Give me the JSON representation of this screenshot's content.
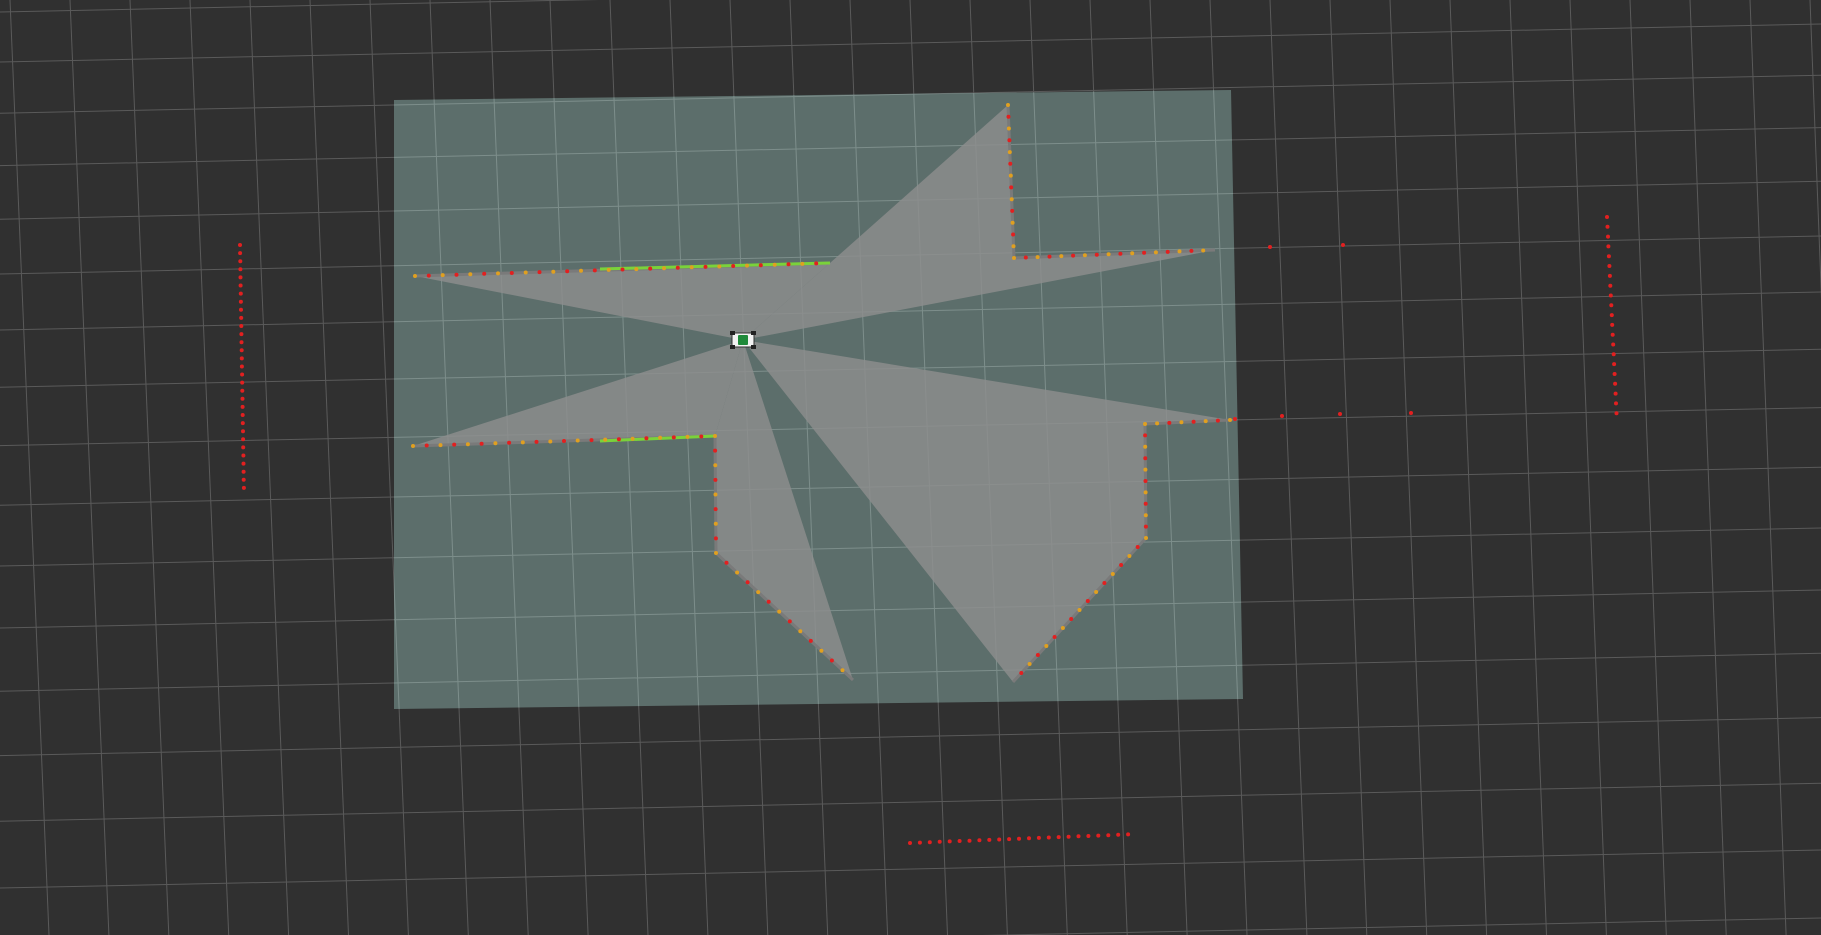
{
  "view": {
    "background_color": "#303030",
    "grid_color": "#5a5a5a",
    "map_color": "#5f726f",
    "scan_color": "#8e8e8e",
    "scan_point_color": "#e22020",
    "scan_point_alt_color": "#e0a020",
    "wall_highlight_color": "#7ad23a"
  },
  "robot": {
    "icon": "robot-car-icon"
  }
}
